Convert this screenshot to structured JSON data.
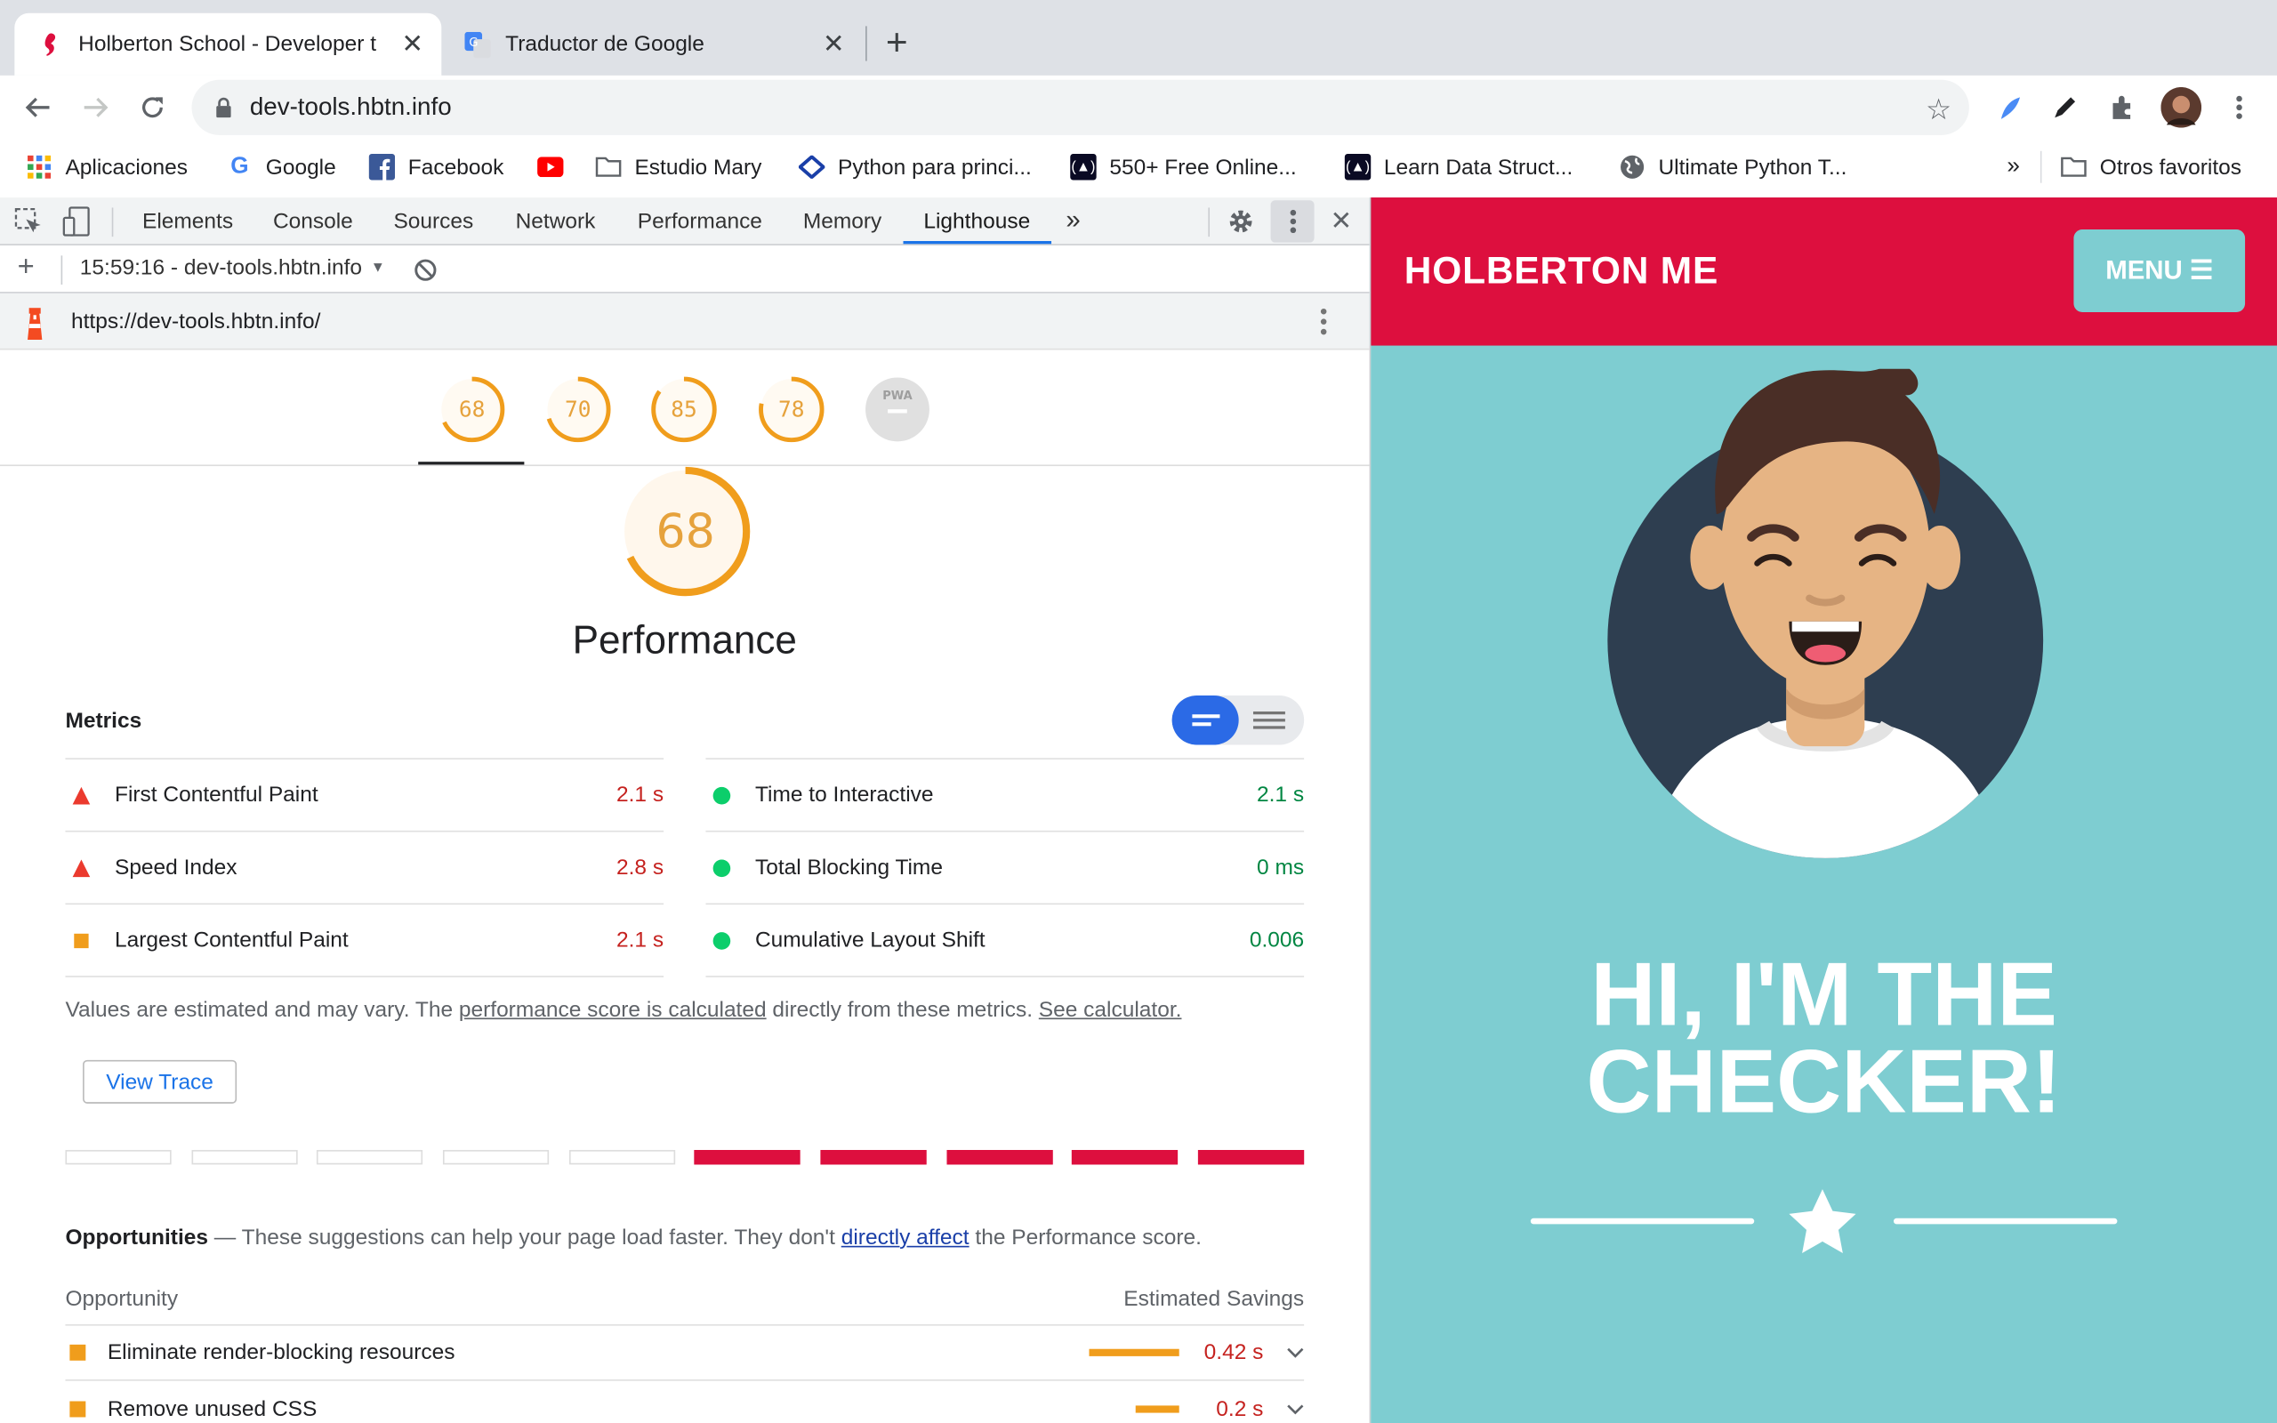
{
  "browser": {
    "tabs": [
      {
        "title": "Holberton School - Developer t",
        "active": true
      },
      {
        "title": "Traductor de Google",
        "active": false
      }
    ],
    "url": "dev-tools.hbtn.info",
    "bookmarks": [
      {
        "label": "Aplicaciones",
        "icon": "apps-grid-icon"
      },
      {
        "label": "Google",
        "icon": "google-icon"
      },
      {
        "label": "Facebook",
        "icon": "facebook-icon"
      },
      {
        "label": "",
        "icon": "youtube-icon"
      },
      {
        "label": "Estudio Mary",
        "icon": "folder-icon"
      },
      {
        "label": "Python para princi...",
        "icon": "site-icon"
      },
      {
        "label": "550+ Free Online...",
        "icon": "freecodecamp-icon"
      },
      {
        "label": "Learn Data Struct...",
        "icon": "freecodecamp-icon"
      },
      {
        "label": "Ultimate Python T...",
        "icon": "globe-icon"
      }
    ],
    "bookmarks_overflow": "»",
    "other_bookmarks": "Otros favoritos"
  },
  "devtools": {
    "tabs": [
      "Elements",
      "Console",
      "Sources",
      "Network",
      "Performance",
      "Memory",
      "Lighthouse"
    ],
    "active_tab": "Lighthouse",
    "more_tabs": "»",
    "report_label": "15:59:16 - dev-tools.hbtn.info",
    "report_url": "https://dev-tools.hbtn.info/"
  },
  "lighthouse": {
    "gauges": [
      {
        "score": "68",
        "fraction": 0.68
      },
      {
        "score": "70",
        "fraction": 0.7
      },
      {
        "score": "85",
        "fraction": 0.85
      },
      {
        "score": "78",
        "fraction": 0.78
      },
      {
        "score": "–",
        "label": "PWA",
        "fraction": 0
      }
    ],
    "performance": {
      "score": "68",
      "fraction": 0.68,
      "title": "Performance",
      "metrics_heading": "Metrics",
      "metrics": [
        {
          "label": "First Contentful Paint",
          "value": "2.1 s",
          "status": "fail"
        },
        {
          "label": "Time to Interactive",
          "value": "2.1 s",
          "status": "pass"
        },
        {
          "label": "Speed Index",
          "value": "2.8 s",
          "status": "fail"
        },
        {
          "label": "Total Blocking Time",
          "value": "0 ms",
          "status": "pass"
        },
        {
          "label": "Largest Contentful Paint",
          "value": "2.1 s",
          "status": "average"
        },
        {
          "label": "Cumulative Layout Shift",
          "value": "0.006",
          "status": "pass"
        }
      ],
      "note_prefix": "Values are estimated and may vary. The ",
      "note_link1": "performance score is calculated",
      "note_middle": " directly from these metrics. ",
      "note_link2": "See calculator.",
      "view_trace": "View Trace"
    },
    "opportunities": {
      "heading": "Opportunities",
      "intro_prefix": " — These suggestions can help your page load faster. They don't ",
      "intro_link": "directly affect",
      "intro_suffix": " the Performance score.",
      "col_opportunity": "Opportunity",
      "col_savings": "Estimated Savings",
      "items": [
        {
          "label": "Eliminate render-blocking resources",
          "savings": "0.42 s"
        },
        {
          "label": "Remove unused CSS",
          "savings": "0.2 s"
        }
      ]
    }
  },
  "page": {
    "brand": "HOLBERTON ME",
    "menu": "MENU ☰",
    "hero_line1": "HI, I'M THE",
    "hero_line2": "CHECKER!"
  },
  "colors": {
    "brand_red": "#dd0f3e",
    "teal": "#7ecdd1",
    "score_orange": "#f09d1c",
    "fail_red": "#eb3a2e",
    "pass_green": "#0cce6b",
    "accent_blue": "#1a73e8"
  }
}
